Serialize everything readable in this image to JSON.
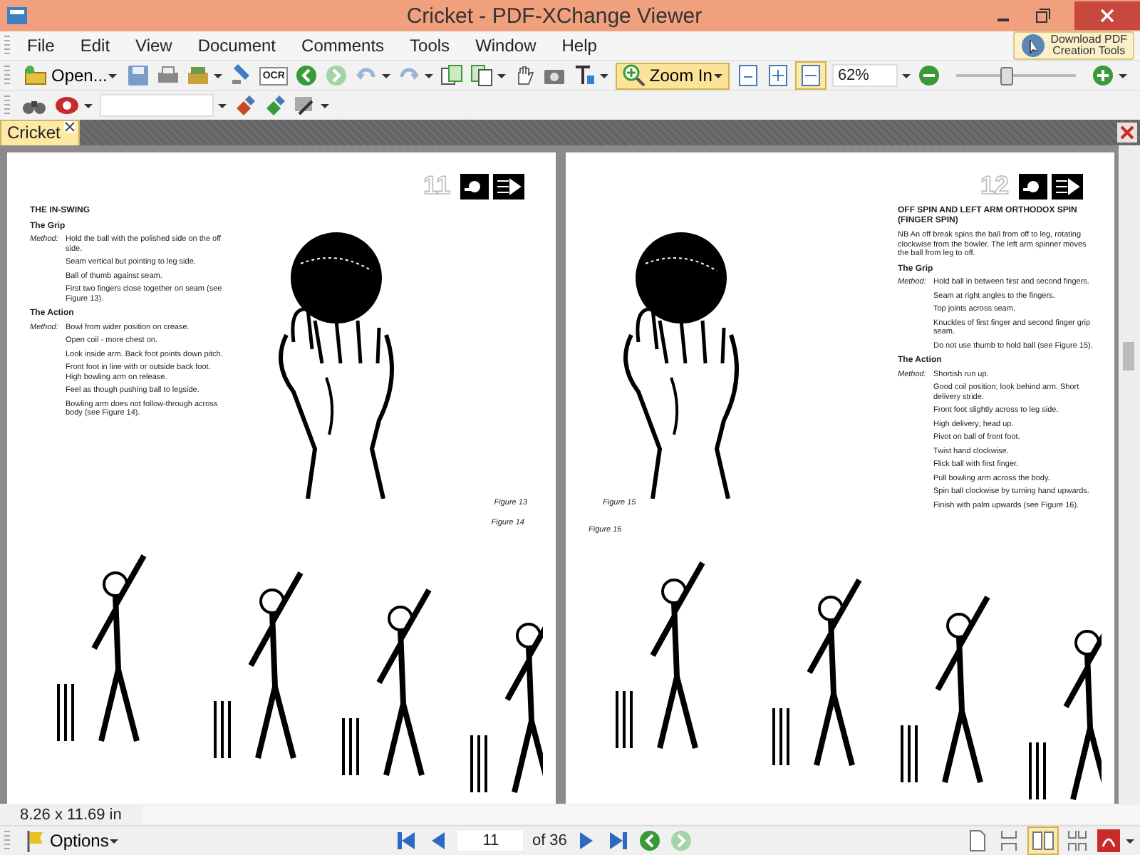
{
  "window": {
    "title": "Cricket - PDF-XChange Viewer"
  },
  "menu": [
    "File",
    "Edit",
    "View",
    "Document",
    "Comments",
    "Tools",
    "Window",
    "Help"
  ],
  "promo": {
    "lines": [
      "Download PDF",
      "Creation Tools"
    ]
  },
  "toolbar": {
    "open_label": "Open...",
    "ocr_label": "OCR",
    "zoom_label": "Zoom In",
    "zoom_active": true,
    "zoom_value": "62%",
    "zoom_slider": {
      "level": 0.4
    }
  },
  "tabs": [
    {
      "label": "Cricket",
      "selected": true
    }
  ],
  "pages": [
    {
      "number": "11",
      "heading": "THE IN-SWING",
      "sections": [
        {
          "title": "The Grip",
          "label": "Method:",
          "items": [
            "Hold the ball with the polished side on the off side.",
            "Seam vertical but pointing to leg side.",
            "Ball of thumb against seam.",
            "First two fingers close together on seam (see Figure 13)."
          ]
        },
        {
          "title": "The Action",
          "label": "Method:",
          "items": [
            "Bowl from wider position on crease.",
            "Open coil - more chest on.",
            "Look inside arm. Back foot points down pitch.",
            "Front foot in line with or outside back foot. High bowling arm on release.",
            "Feel as though pushing ball to legside.",
            "Bowling arm does not follow-through across body (see Figure 14)."
          ]
        }
      ],
      "top_caption": "Figure 13",
      "bottom_caption": "Figure 14"
    },
    {
      "number": "12",
      "heading": "OFF SPIN AND LEFT ARM ORTHODOX SPIN (FINGER SPIN)",
      "intro": "NB An off break spins the ball from off to leg, rotating clockwise from the bowler. The left arm spinner moves the ball from leg to off.",
      "sections": [
        {
          "title": "The Grip",
          "label": "Method:",
          "items": [
            "Hold ball in between first and second fingers.",
            "Seam at right angles to the fingers.",
            "Top joints across seam.",
            "Knuckles of first finger and second finger grip seam.",
            "Do not use thumb to hold ball (see Figure 15)."
          ]
        },
        {
          "title": "The Action",
          "label": "Method:",
          "items": [
            "Shortish run up.",
            "Good coil position; look behind arm. Short delivery stride.",
            "Front foot slightly across to leg side.",
            "High delivery; head up.",
            "Pivot on ball of front foot.",
            "Twist hand clockwise.",
            "Flick ball with first finger.",
            "Pull bowling arm across the body.",
            "Spin ball clockwise by turning hand upwards.",
            "Finish with palm upwards (see Figure 16)."
          ]
        }
      ],
      "top_caption": "Figure 15",
      "bottom_caption": "Figure 16"
    }
  ],
  "status": {
    "page_size": "8.26 x 11.69 in"
  },
  "bottom_bar": {
    "options_label": "Options",
    "page_input": "11",
    "page_total": "of 36"
  }
}
